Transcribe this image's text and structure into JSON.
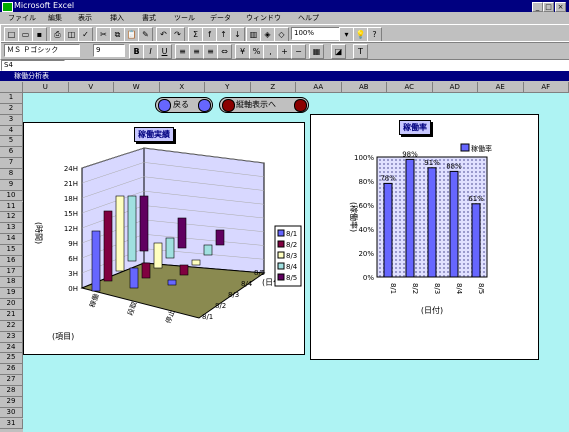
{
  "window": {
    "title": "Microsoft Excel"
  },
  "menu": [
    "ファイル",
    "編集",
    "表示",
    "挿入",
    "書式",
    "ツール",
    "データ",
    "ウィンドウ",
    "ヘルプ"
  ],
  "toolbar": {
    "zoom": "100%",
    "font": "ＭＳ Ｐゴシック",
    "size": "9"
  },
  "namebox": "S4",
  "sheet": {
    "title": "稼働分析表"
  },
  "columns": [
    "U",
    "V",
    "W",
    "X",
    "Y",
    "Z",
    "AA",
    "AB",
    "AC",
    "AD",
    "AE",
    "AF"
  ],
  "rows": [
    "1",
    "2",
    "3",
    "4",
    "5",
    "6",
    "7",
    "8",
    "9",
    "10",
    "11",
    "12",
    "13",
    "14",
    "15",
    "16",
    "17",
    "18",
    "19",
    "20",
    "21",
    "22",
    "23",
    "24",
    "25",
    "26",
    "27",
    "28",
    "29",
    "30",
    "31"
  ],
  "buttons": {
    "back": "戻る",
    "vertical": "縦軸表示へ"
  },
  "chart_left": {
    "title": "稼働実績",
    "ylabel": "(時間)",
    "yticks": [
      "24H",
      "21H",
      "18H",
      "15H",
      "12H",
      "9H",
      "6H",
      "3H",
      "0H"
    ],
    "xlabel": "(項目)",
    "zlabel": "(日付)",
    "categories": [
      "稼働",
      "段取",
      "停止"
    ],
    "dates": [
      "8/1",
      "8/2",
      "8/3",
      "8/4",
      "8/5"
    ],
    "legend": [
      "8/1",
      "8/2",
      "8/3",
      "8/4",
      "8/5"
    ]
  },
  "chart_right": {
    "title": "稼働率",
    "legend": "稼働率",
    "ylabel": "(稼働率)",
    "xlabel": "(日付)",
    "yticks": [
      "100%",
      "80%",
      "60%",
      "40%",
      "20%",
      "0%"
    ],
    "categories": [
      "8/1",
      "8/2",
      "8/3",
      "8/4",
      "8/5"
    ],
    "labels": [
      "78%",
      "98%",
      "91%",
      "88%",
      "61%"
    ]
  },
  "chart_data": [
    {
      "type": "bar",
      "title": "稼働実績",
      "ylabel": "(時間)",
      "xlabel": "(項目)",
      "categories": [
        "稼働",
        "段取",
        "停止"
      ],
      "series": [
        {
          "name": "8/1",
          "values": [
            12,
            4,
            1
          ]
        },
        {
          "name": "8/2",
          "values": [
            14,
            3,
            2
          ]
        },
        {
          "name": "8/3",
          "values": [
            15,
            5,
            1
          ]
        },
        {
          "name": "8/4",
          "values": [
            13,
            4,
            2
          ]
        },
        {
          "name": "8/5",
          "values": [
            11,
            6,
            3
          ]
        }
      ],
      "ylim": [
        0,
        24
      ]
    },
    {
      "type": "bar",
      "title": "稼働率",
      "ylabel": "(稼働率)",
      "xlabel": "(日付)",
      "categories": [
        "8/1",
        "8/2",
        "8/3",
        "8/4",
        "8/5"
      ],
      "series": [
        {
          "name": "稼働率",
          "values": [
            78,
            98,
            91,
            88,
            61
          ]
        }
      ],
      "ylim": [
        0,
        100
      ]
    }
  ],
  "colors": {
    "bar_blue": "#6666ff",
    "sheet_bg": "#aef3f3",
    "title_bar": "#000080"
  }
}
